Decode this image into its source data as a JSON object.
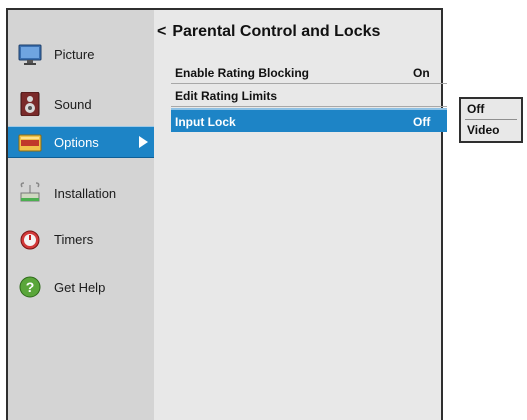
{
  "sidebar": {
    "items": [
      {
        "label": "Picture",
        "icon": "monitor-icon"
      },
      {
        "label": "Sound",
        "icon": "speaker-icon"
      },
      {
        "label": "Options",
        "icon": "options-icon",
        "selected": true
      },
      {
        "label": "Installation",
        "icon": "satellite-icon"
      },
      {
        "label": "Timers",
        "icon": "timer-icon"
      },
      {
        "label": "Get Help",
        "icon": "help-icon"
      }
    ]
  },
  "main": {
    "back_glyph": "<",
    "title": "Parental Control and Locks",
    "rows": [
      {
        "label": "Enable Rating Blocking",
        "value": "On"
      },
      {
        "label": "Edit Rating Limits",
        "value": ""
      },
      {
        "label": "Input Lock",
        "value": "Off",
        "selected": true
      }
    ]
  },
  "popup": {
    "options": [
      "Off",
      "Video"
    ]
  },
  "colors": {
    "accent": "#1d84c6",
    "panel": "#e8e8e8",
    "sidebar": "#d4d4d4",
    "border": "#2f2f2f"
  }
}
